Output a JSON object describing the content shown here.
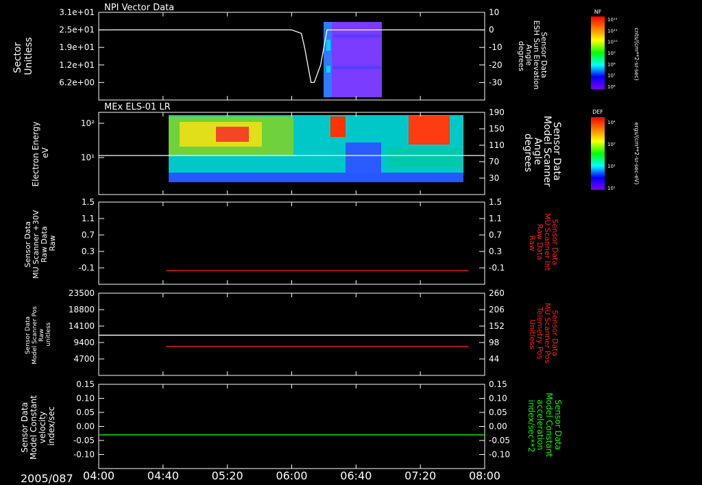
{
  "date_label": "2005/087",
  "time_ticks": [
    "04:00",
    "04:40",
    "05:20",
    "06:00",
    "06:40",
    "07:20",
    "08:00"
  ],
  "panels": [
    {
      "title": "NPI Vector Data",
      "left_label": [
        "Sector",
        "Unitless"
      ],
      "left_ticks": [
        "3.1e+01",
        "2.5e+01",
        "1.9e+01",
        "1.2e+01",
        "6.2e+00"
      ],
      "right_ticks": [
        "10",
        "0",
        "-10",
        "-20",
        "-30"
      ],
      "right_label": [
        "Sensor Data",
        "ESH Sun Elevation",
        "Angle",
        "degrees"
      ],
      "right_label_color": "#ffffff",
      "colorbar": {
        "label": "NF",
        "ticks": [
          "10¹²",
          "10¹¹",
          "10¹⁰",
          "10⁹",
          "10⁸",
          "10⁷",
          "10⁶"
        ],
        "units": "cnts/(cm**2-sr-sec)"
      }
    },
    {
      "title": "MEx ELS-01 LR",
      "left_label": [
        "Electron Energy",
        "eV"
      ],
      "left_ticks": [
        "10²",
        "10¹"
      ],
      "right_ticks": [
        "190",
        "150",
        "110",
        "70",
        "30"
      ],
      "right_label": [
        "Sensor Data",
        "Model Scanner",
        "Angle",
        "degrees"
      ],
      "right_label_color": "#ffffff",
      "colorbar": {
        "label": "DEF",
        "ticks": [
          "10⁴",
          "10³",
          "10²",
          "10¹"
        ],
        "units": "ergs/(cm**2-sr-sec-eV)"
      }
    },
    {
      "title": "",
      "left_label": [
        "Sensor Data",
        "MU Scanner +30V",
        "Raw Data",
        "Raw"
      ],
      "left_ticks": [
        "1.5",
        "1.1",
        "0.7",
        "0.3",
        "-0.1"
      ],
      "right_ticks": [
        "1.5",
        "1.1",
        "0.7",
        "0.3",
        "-0.1"
      ],
      "right_label": [
        "Sensor Data",
        "MU Scanner Int",
        "Raw Data",
        "Raw"
      ],
      "right_label_color": "#ff2020"
    },
    {
      "title": "",
      "left_label": [
        "Sensor Data",
        "Model Scanner Pos",
        "Raw",
        "unitless"
      ],
      "left_ticks": [
        "23500",
        "18800",
        "14100",
        "9400",
        "4700"
      ],
      "right_ticks": [
        "260",
        "206",
        "152",
        "98",
        "44"
      ],
      "right_label": [
        "Sensor Data",
        "MU Scanner Pos",
        "Telemetry Pos",
        "Unitless"
      ],
      "right_label_color": "#ff2020"
    },
    {
      "title": "",
      "left_label": [
        "Sensor Data",
        "Model Constant",
        "velocity",
        "index/sec"
      ],
      "left_ticks": [
        "0.15",
        "0.10",
        "0.05",
        "0.00",
        "-0.05",
        "-0.10"
      ],
      "right_ticks": [
        "0.15",
        "0.10",
        "0.05",
        "0.00",
        "-0.05",
        "-0.10"
      ],
      "right_label": [
        "Sensor Data",
        "Model Constant",
        "acceleration",
        "index/sec**2"
      ],
      "right_label_color": "#00ff00"
    }
  ],
  "chart_data": [
    {
      "type": "line",
      "x_range": [
        "04:00",
        "08:00"
      ],
      "spectrogram_time_range": [
        "06:10",
        "06:55"
      ],
      "series": [
        {
          "values_time": [
            "04:00",
            "06:00",
            "06:06",
            "06:08",
            "06:12",
            "06:14",
            "06:18",
            "06:22",
            "08:00"
          ],
          "values": [
            0,
            0,
            -2,
            -10,
            -30,
            -30,
            -20,
            0,
            0
          ],
          "color": "#ffffff"
        }
      ]
    },
    {
      "type": "heatmap",
      "time_range": [
        "04:42",
        "07:50"
      ],
      "ylim": [
        1,
        150
      ],
      "hotspots": [
        "05:25",
        "06:25",
        "07:25"
      ],
      "series": [
        {
          "values_time": [
            "04:00",
            "08:00"
          ],
          "values": [
            85,
            85
          ],
          "color": "#ffffff"
        }
      ]
    },
    {
      "type": "line",
      "ylim": [
        -0.35,
        1.5
      ],
      "series": [
        {
          "values_time": [
            "04:42",
            "07:50"
          ],
          "values": [
            -0.04,
            -0.04
          ],
          "color": "#ff2020"
        }
      ]
    },
    {
      "type": "line",
      "ylim": [
        0,
        23500
      ],
      "series": [
        {
          "values_time": [
            "04:00",
            "08:00"
          ],
          "values": [
            11500,
            11500
          ],
          "color": "#ffffff"
        },
        {
          "values_time": [
            "04:42",
            "07:50"
          ],
          "values": [
            8300,
            8300
          ],
          "color": "#ff2020"
        }
      ]
    },
    {
      "type": "line",
      "ylim": [
        -0.1,
        0.15
      ],
      "series": [
        {
          "values_time": [
            "04:00",
            "08:00"
          ],
          "values": [
            0.0,
            0.0
          ],
          "color": "#00ff00"
        }
      ]
    }
  ]
}
